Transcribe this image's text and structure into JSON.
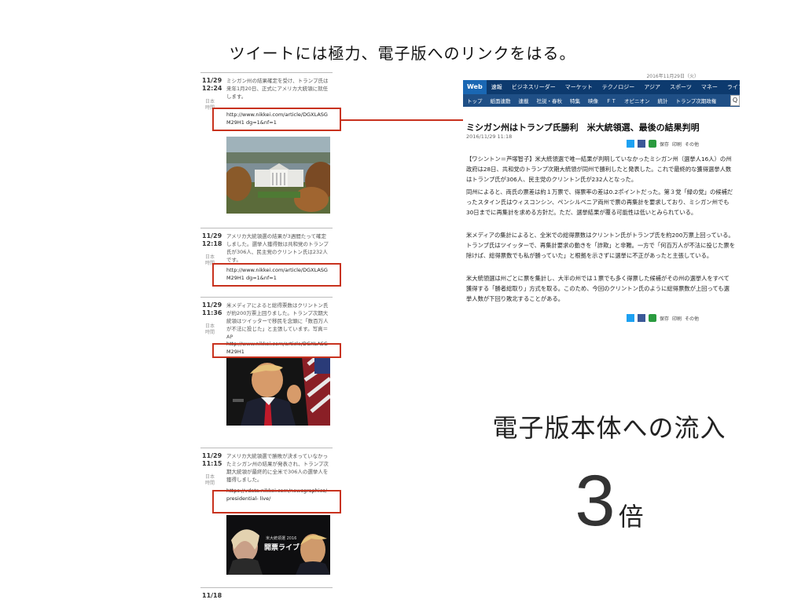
{
  "headline": "ツイートには極力、電子版へのリンクをはる。",
  "timeline": {
    "items": [
      {
        "date": "11/29",
        "time": "12:24",
        "meta": "日本 時間",
        "text": "ミシガン州の結果確定を受け、トランプ氏は来年1月20日、正式にアメリカ大統領に就任します。",
        "link": "http://www.nikkei.com/article/DGXLASGM29H1 dg=1&nf=1",
        "photo": "white-house"
      },
      {
        "date": "11/29",
        "time": "12:18",
        "meta": "日本 時間",
        "text": "アメリカ大統領選の結果が3週間たって確定しました。選挙人獲得数は共和党のトランプ氏が306人、民主党のクリントン氏は232人です。",
        "link": "http://www.nikkei.com/article/DGXLASGM29H1 dg=1&nf=1",
        "photo": null
      },
      {
        "date": "11/29",
        "time": "11:36",
        "meta": "日本 時間",
        "text": "米メディアによると総得票数はクリントン氏が約200万票上回りました。トランプ次期大統領はツイッターで移民を念頭に「数百万人が不法に投じた」と主張しています。写真＝AP",
        "link": "http://www.nikkei.com/article/DGXLASGM29H1",
        "photo": "trump"
      },
      {
        "date": "11/29",
        "time": "11:15",
        "meta": "日本 時間",
        "text": "アメリカ大統領選で勝敗が決まっていなかったミシガン州の結果が発表され、トランプ次期大統領が最終的に全米で306人の選挙人を獲得しました。",
        "link": "https://vdata.nikkei.com/newsgraphics/presidential- live/",
        "photo": "election-live",
        "photo_caption_1": "米大統領選 2016",
        "photo_caption_2": "開票ライブ"
      },
      {
        "date": "11/18",
        "time": "",
        "meta": "",
        "text": "",
        "link": "",
        "photo": null
      }
    ]
  },
  "article": {
    "top_date": "2016年11月29日（火）",
    "nav_primary": [
      "Web刊",
      "速報",
      "ビジネスリーダー",
      "マーケット",
      "テクノロジー",
      "アジア",
      "スポーツ",
      "マネー",
      "ライフ"
    ],
    "nav_secondary": [
      "トップ",
      "紙面連動",
      "連載",
      "社説・春秋",
      "特集",
      "映像",
      "ＦＴ",
      "オピニオン",
      "統計",
      "トランプ次期政権"
    ],
    "title": "ミシガン州はトランプ氏勝利　米大統領選、最後の結果判明",
    "date": "2016/11/29 11:18",
    "share_labels": [
      "保存",
      "印刷",
      "その他"
    ],
    "paragraphs": [
      "【ワシントン＝芦塚智子】米大統領選で唯一結果が判明していなかったミシガン州（選挙人16人）の州政府は28日、共和党のトランプ次期大統領が同州で勝利したと発表した。これで最終的な獲得選挙人数はトランプ氏が306人、民主党のクリントン氏が232人となった。",
      "同州によると、両氏の票差は約１万票で、得票率の差は0.2ポイントだった。第３党「緑の党」の候補だったスタイン氏はウィスコンシン、ペンシルベニア両州で票の再集計を要求しており、ミシガン州でも30日までに再集計を求める方針だ。ただ、選挙結果が覆る可能性は低いとみられている。",
      "米メディアの集計によると、全米での総得票数はクリントン氏がトランプ氏を約200万票上回っている。トランプ氏はツイッターで、再集計要求の動きを「詐欺」と非難。一方で「何百万人が不法に投じた票を除けば、総得票数でも私が勝っていた」と根拠を示さずに選挙に不正があったと主張している。",
      "米大統領選は州ごとに票を集計し、大半の州では１票でも多く得票した候補がその州の選挙人をすべて獲得する「勝者総取り」方式を取る。このため、今回のクリントン氏のように総得票数が上回っても選挙人数が下回り敗北することがある。"
    ]
  },
  "caption": "電子版本体への流入",
  "multiplier": {
    "value": "3",
    "unit": "倍"
  },
  "colors": {
    "highlight": "#c8321e",
    "nav_primary": "#0d3a6e",
    "nav_secondary": "#1f4f86"
  }
}
